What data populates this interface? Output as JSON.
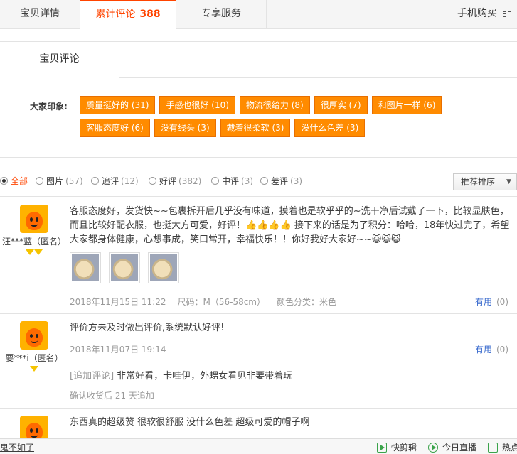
{
  "tabs": [
    {
      "label": "宝贝详情"
    },
    {
      "label": "累计评论",
      "count": "388"
    },
    {
      "label": "专享服务"
    }
  ],
  "mobile_buy": "手机购买",
  "subtab": "宝贝评论",
  "impression_label": "大家印象:",
  "tags": [
    "质量挺好的 (31)",
    "手感也很好 (10)",
    "物流很给力 (8)",
    "很厚实 (7)",
    "和图片一样 (6)",
    "客服态度好 (6)",
    "没有线头 (3)",
    "戴着很柔软 (3)",
    "没什么色差 (3)"
  ],
  "filters": [
    {
      "label": "全部",
      "count": ""
    },
    {
      "label": "图片",
      "count": "(57)"
    },
    {
      "label": "追评",
      "count": "(12)"
    },
    {
      "label": "好评",
      "count": "(382)"
    },
    {
      "label": "中评",
      "count": "(3)"
    },
    {
      "label": "差评",
      "count": "(3)"
    }
  ],
  "sort_label": "推荐排序",
  "reviews": [
    {
      "user": "汪***蓝（匿名）",
      "content": "客服态度好，发货快~~包裹拆开后几乎没有味道，摸着也是软乎乎的~洗干净后试戴了一下，比较显肤色，而且比较好配衣服，也挺大方可爱，好评！👍👍👍👍 接下来的话是为了积分：哈哈，18年快过完了，希望大家都身体健康，心想事成，笑口常开，幸福快乐！！你好我好大家好~~😺😺😺",
      "date": "2018年11月15日 11:22",
      "size": "尺码：M（56-58cm）",
      "color": "颜色分类：米色",
      "useful": "有用",
      "useful_count": "(0)"
    },
    {
      "user": "要***i（匿名）",
      "content": "评价方未及时做出评价,系统默认好评!",
      "date": "2018年11月07日 19:14",
      "useful": "有用",
      "useful_count": "(0)",
      "append_tag": "[追加评论]",
      "append_text": "非常好看，卡哇伊，外甥女看见非要带着玩",
      "append_meta": "确认收货后 21 天追加"
    },
    {
      "content": "东西真的超级赞 很软很舒服 没什么色差 超级可爱的帽子啊"
    }
  ],
  "bottom": {
    "link": "鬼不如了",
    "items": [
      "快剪辑",
      "今日直播",
      "热点"
    ]
  },
  "accent": "#ff4400",
  "tag_color": "#ff8b00"
}
